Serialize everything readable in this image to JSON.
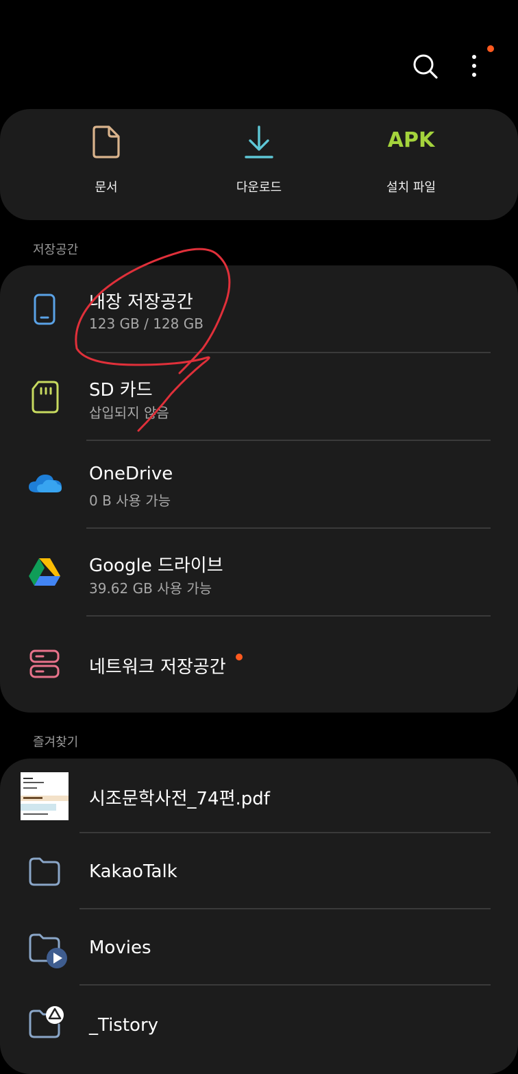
{
  "toolbar": {
    "search_icon": "search-icon",
    "more_icon": "more-vert-icon",
    "notification_dot_color": "#ff5a1f"
  },
  "quick_access": [
    {
      "label": "문서",
      "icon": "document-icon",
      "color": "#d9b38c"
    },
    {
      "label": "다운로드",
      "icon": "download-icon",
      "color": "#5ec7d6"
    },
    {
      "label": "설치 파일",
      "icon": "apk-icon",
      "icon_text": "APK",
      "color": "#a4d33c"
    }
  ],
  "storage": {
    "section_title": "저장공간",
    "items": [
      {
        "title": "내장 저장공간",
        "subtitle": "123 GB / 128 GB",
        "icon": "phone-icon",
        "color": "#5aa2e6"
      },
      {
        "title": "SD 카드",
        "subtitle": "삽입되지 않음",
        "icon": "sd-card-icon",
        "color": "#c7da5f"
      },
      {
        "title": "OneDrive",
        "subtitle": "0 B 사용 가능",
        "icon": "onedrive-icon",
        "color": "#1e7fd8"
      },
      {
        "title": "Google 드라이브",
        "subtitle": "39.62 GB 사용 가능",
        "icon": "google-drive-icon",
        "color": "#34a853"
      },
      {
        "title": "네트워크 저장공간",
        "subtitle": "",
        "icon": "network-storage-icon",
        "color": "#e8738b"
      }
    ]
  },
  "favorites": {
    "section_title": "즐겨찾기",
    "items": [
      {
        "title": "시조문학사전_74편.pdf",
        "icon": "pdf-thumbnail"
      },
      {
        "title": "KakaoTalk",
        "icon": "folder-icon"
      },
      {
        "title": "Movies",
        "icon": "folder-video-icon"
      },
      {
        "title": "_Tistory",
        "icon": "folder-drive-icon"
      }
    ]
  },
  "annotation": {
    "color": "#e0303a"
  }
}
